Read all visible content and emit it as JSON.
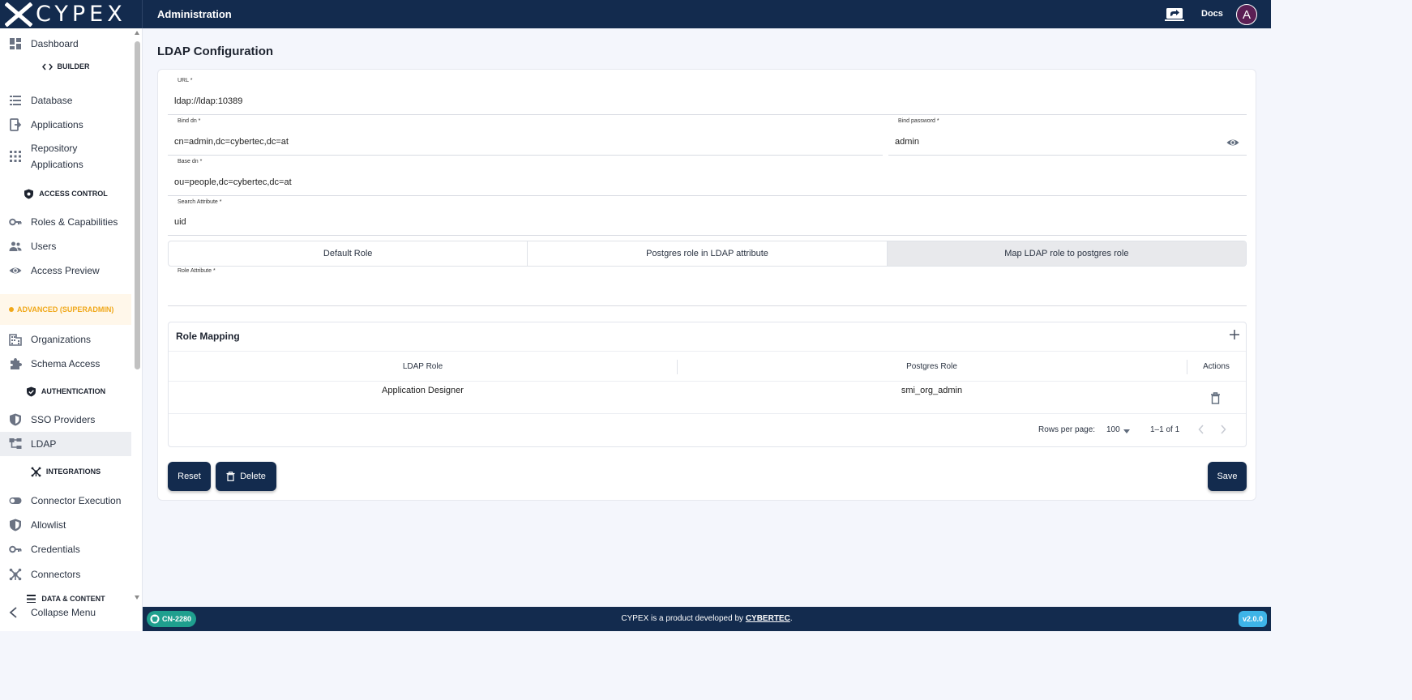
{
  "topbar": {
    "logo_text": "CYPEX",
    "title": "Administration",
    "docs_label": "Docs",
    "avatar_initial": "A"
  },
  "sidebar": {
    "items": {
      "dashboard": "Dashboard",
      "builder": "BUILDER",
      "database": "Database",
      "applications": "Applications",
      "repository_line1": "Repository",
      "repository_line2": "Applications",
      "access_control": "ACCESS CONTROL",
      "roles": "Roles & Capabilities",
      "users": "Users",
      "access_preview": "Access Preview",
      "advanced": "ADVANCED (SUPERADMIN)",
      "organizations": "Organizations",
      "schema_access": "Schema Access",
      "authentication": "AUTHENTICATION",
      "sso": "SSO Providers",
      "ldap": "LDAP",
      "integrations": "INTEGRATIONS",
      "connector_execution": "Connector Execution",
      "allowlist": "Allowlist",
      "credentials": "Credentials",
      "connectors": "Connectors",
      "data_content": "DATA & CONTENT"
    },
    "collapse_label": "Collapse Menu"
  },
  "main": {
    "page_title": "LDAP Configuration",
    "fields": {
      "url_label": "URL *",
      "url_value": "ldap://ldap:10389",
      "bind_dn_label": "Bind dn *",
      "bind_dn_value": "cn=admin,dc=cybertec,dc=at",
      "bind_password_label": "Bind password *",
      "bind_password_value": "admin",
      "base_dn_label": "Base dn *",
      "base_dn_value": "ou=people,dc=cybertec,dc=at",
      "search_attr_label": "Search Attribute *",
      "search_attr_value": "uid",
      "role_attr_label": "Role Attribute *",
      "role_attr_value": ""
    },
    "role_tabs": [
      "Default Role",
      "Postgres role in LDAP attribute",
      "Map LDAP role to postgres role"
    ],
    "role_tab_selected": "Map LDAP role to postgres role",
    "role_mapping": {
      "title": "Role Mapping",
      "columns": [
        "LDAP Role",
        "Postgres Role",
        "Actions"
      ],
      "rows": [
        {
          "ldap_role": "Application Designer",
          "postgres_role": "smi_org_admin"
        }
      ],
      "rows_per_page_label": "Rows per page:",
      "rows_per_page_value": "100",
      "range": "1–1 of 1"
    },
    "buttons": {
      "reset": "Reset",
      "delete": "Delete",
      "save": "Save"
    }
  },
  "footer": {
    "badge": "CN-2280",
    "credit_prefix": "CYPEX is a product developed by",
    "credit_company": "CYBERTEC",
    "credit_suffix": ".",
    "version": "v2.0.0"
  }
}
